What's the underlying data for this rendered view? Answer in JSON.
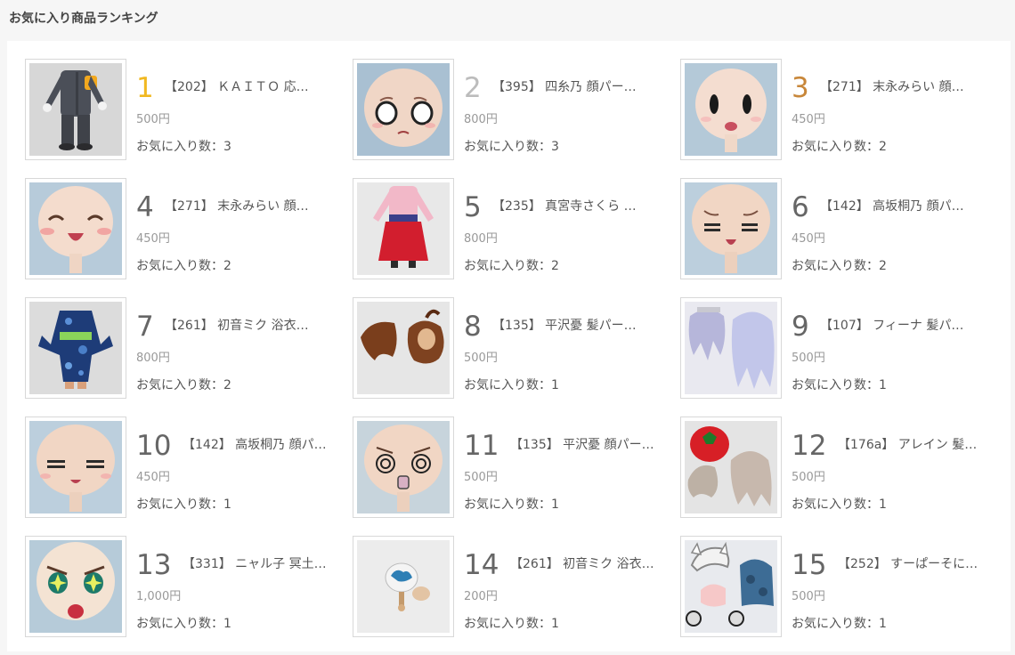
{
  "section_title": "お気に入り商品ランキング",
  "colors": {
    "rank1": "#f1b820",
    "rank2": "#bcbcbc",
    "rank3": "#c8873a",
    "rank_default": "#666666"
  },
  "items": [
    {
      "rank": "1",
      "name": "【202】 ＫＡＩＴＯ 応…",
      "price": "500円",
      "fav": "お気に入り数：3",
      "image": "kaito-body-image"
    },
    {
      "rank": "2",
      "name": "【395】 四糸乃 顔パー…",
      "price": "800円",
      "fav": "お気に入り数：3",
      "image": "shocked-face-image"
    },
    {
      "rank": "3",
      "name": "【271】 末永みらい 顔…",
      "price": "450円",
      "fav": "お気に入り数：2",
      "image": "simple-face-image"
    },
    {
      "rank": "4",
      "name": "【271】 末永みらい 顔…",
      "price": "450円",
      "fav": "お気に入り数：2",
      "image": "laughing-face-image"
    },
    {
      "rank": "5",
      "name": "【235】 真宮寺さくら …",
      "price": "800円",
      "fav": "お気に入り数：2",
      "image": "hakama-body-image"
    },
    {
      "rank": "6",
      "name": "【142】 高坂桐乃 顔パ…",
      "price": "450円",
      "fav": "お気に入り数：2",
      "image": "closed-eyes-face-image"
    },
    {
      "rank": "7",
      "name": "【261】 初音ミク 浴衣…",
      "price": "800円",
      "fav": "お気に入り数：2",
      "image": "yukata-body-image"
    },
    {
      "rank": "8",
      "name": "【135】 平沢憂 髪パー…",
      "price": "500円",
      "fav": "お気に入り数：1",
      "image": "brown-hair-image"
    },
    {
      "rank": "9",
      "name": "【107】 フィーナ 髪パ…",
      "price": "500円",
      "fav": "お気に入り数：1",
      "image": "silver-hair-image"
    },
    {
      "rank": "10",
      "name": "【142】 高坂桐乃 顔パ…",
      "price": "450円",
      "fav": "お気に入り数：1",
      "image": "squint-face-image"
    },
    {
      "rank": "11",
      "name": "【135】 平沢憂 顔パー…",
      "price": "500円",
      "fav": "お気に入り数：1",
      "image": "dizzy-face-image"
    },
    {
      "rank": "12",
      "name": "【176a】 アレイン 髪…",
      "price": "500円",
      "fav": "お気に入り数：1",
      "image": "tomato-hair-image"
    },
    {
      "rank": "13",
      "name": "【331】 ニャル子 冥土…",
      "price": "1,000円",
      "fav": "お気に入り数：1",
      "image": "sparkle-eyes-face-image"
    },
    {
      "rank": "14",
      "name": "【261】 初音ミク 浴衣…",
      "price": "200円",
      "fav": "お気に入り数：1",
      "image": "uchiwa-fan-image"
    },
    {
      "rank": "15",
      "name": "【252】 すーぱーそに…",
      "price": "500円",
      "fav": "お気に入り数：1",
      "image": "headphones-parts-image"
    }
  ]
}
